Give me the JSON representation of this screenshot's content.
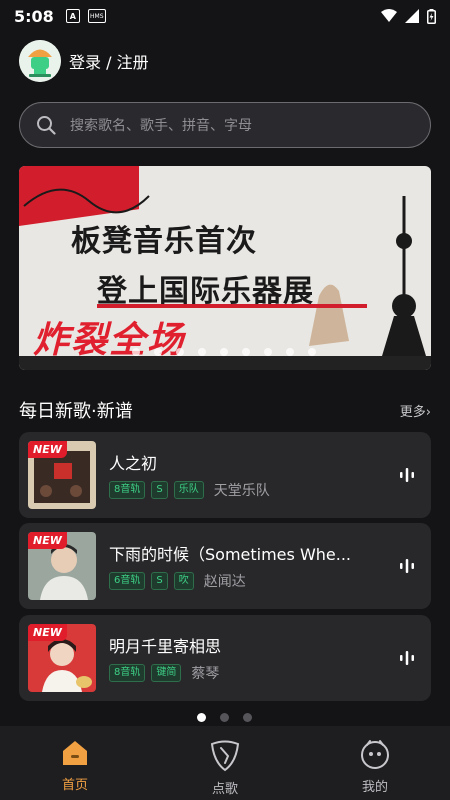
{
  "status_bar": {
    "time": "5:08",
    "badge_a": "A",
    "badge_hms": "HMS"
  },
  "user": {
    "login_text": "登录 / 注册"
  },
  "search": {
    "placeholder": "搜索歌名、歌手、拼音、字母"
  },
  "banner": {
    "line1": "板凳音乐首次",
    "line2": "登上国际乐器展",
    "line3": "炸裂全场",
    "slide_count": 9
  },
  "section": {
    "title": "每日新歌·新谱",
    "more": "更多›"
  },
  "songs": [
    {
      "badge": "NEW",
      "title": "人之初",
      "tags": [
        "8音轨",
        "S",
        "乐队"
      ],
      "artist": "天堂乐队",
      "cover_color": "#3a2a24"
    },
    {
      "badge": "NEW",
      "title": "下雨的时候（Sometimes Whe...",
      "tags": [
        "6音轨",
        "S",
        "吹"
      ],
      "artist": "赵闻达",
      "cover_color": "#6b7a72"
    },
    {
      "badge": "NEW",
      "title": "明月千里寄相思",
      "tags": [
        "8音轨",
        "键简"
      ],
      "artist": "蔡琴",
      "cover_color": "#d83a3a"
    }
  ],
  "pager": {
    "count": 3,
    "active_index": 0
  },
  "tabs": [
    {
      "label": "首页",
      "icon": "home-icon",
      "active": true
    },
    {
      "label": "点歌",
      "icon": "guitar-pick-icon",
      "active": false
    },
    {
      "label": "我的",
      "icon": "face-icon",
      "active": false
    }
  ],
  "colors": {
    "accent": "#f2a142",
    "tag_green": "#3ecf86",
    "new_red": "#e21d2b"
  }
}
